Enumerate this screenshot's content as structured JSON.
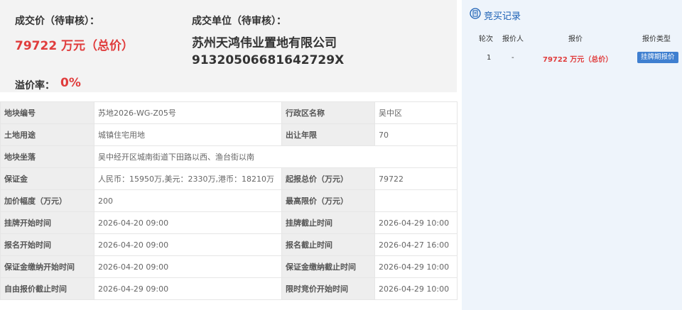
{
  "summary": {
    "price_label": "成交价（待审核）：",
    "price_value": "79722 万元（总价）",
    "unit_label": "成交单位（待审核）：",
    "company_name": "苏州天鸿伟业置地有限公司",
    "company_code": "91320506681642729X",
    "premium_label": "溢价率：",
    "premium_value": "0%"
  },
  "info_rows": [
    {
      "k1": "地块编号",
      "v1": "苏地2026-WG-Z05号",
      "k2": "行政区名称",
      "v2": "吴中区"
    },
    {
      "k1": "土地用途",
      "v1": "城镇住宅用地",
      "k2": "出让年限",
      "v2": "70"
    },
    {
      "k1": "地块坐落",
      "v1": "吴中经开区城南街道下田路以西、渔台街以南"
    },
    {
      "k1": "保证金",
      "v1": "人民币：15950万,美元：2330万,港币：18210万",
      "k2": "起报总价（万元）",
      "v2": "79722"
    },
    {
      "k1": "加价幅度（万元）",
      "v1": "200",
      "k2": "最高限价（万元）",
      "v2": ""
    },
    {
      "k1": "挂牌开始时间",
      "v1": "2026-04-20 09:00",
      "k2": "挂牌截止时间",
      "v2": "2026-04-29 10:00"
    },
    {
      "k1": "报名开始时间",
      "v1": "2026-04-20 09:00",
      "k2": "报名截止时间",
      "v2": "2026-04-27 16:00"
    },
    {
      "k1": "保证金缴纳开始时间",
      "v1": "2026-04-20 09:00",
      "k2": "保证金缴纳截止时间",
      "v2": "2026-04-29 10:00"
    },
    {
      "k1": "自由报价截止时间",
      "v1": "2026-04-29 09:00",
      "k2": "限时竞价开始时间",
      "v2": "2026-04-29 10:00"
    }
  ],
  "bidding": {
    "title": "竞买记录",
    "columns": [
      "轮次",
      "报价人",
      "报价",
      "报价类型"
    ],
    "rows": [
      {
        "round": "1",
        "bidder": "-",
        "price": "79722 万元（总价）",
        "type": "挂牌期报价"
      }
    ]
  },
  "colors": {
    "accent_red": "#e03c3c",
    "accent_blue": "#1a5fb4",
    "badge_blue": "#3f7fd0"
  }
}
